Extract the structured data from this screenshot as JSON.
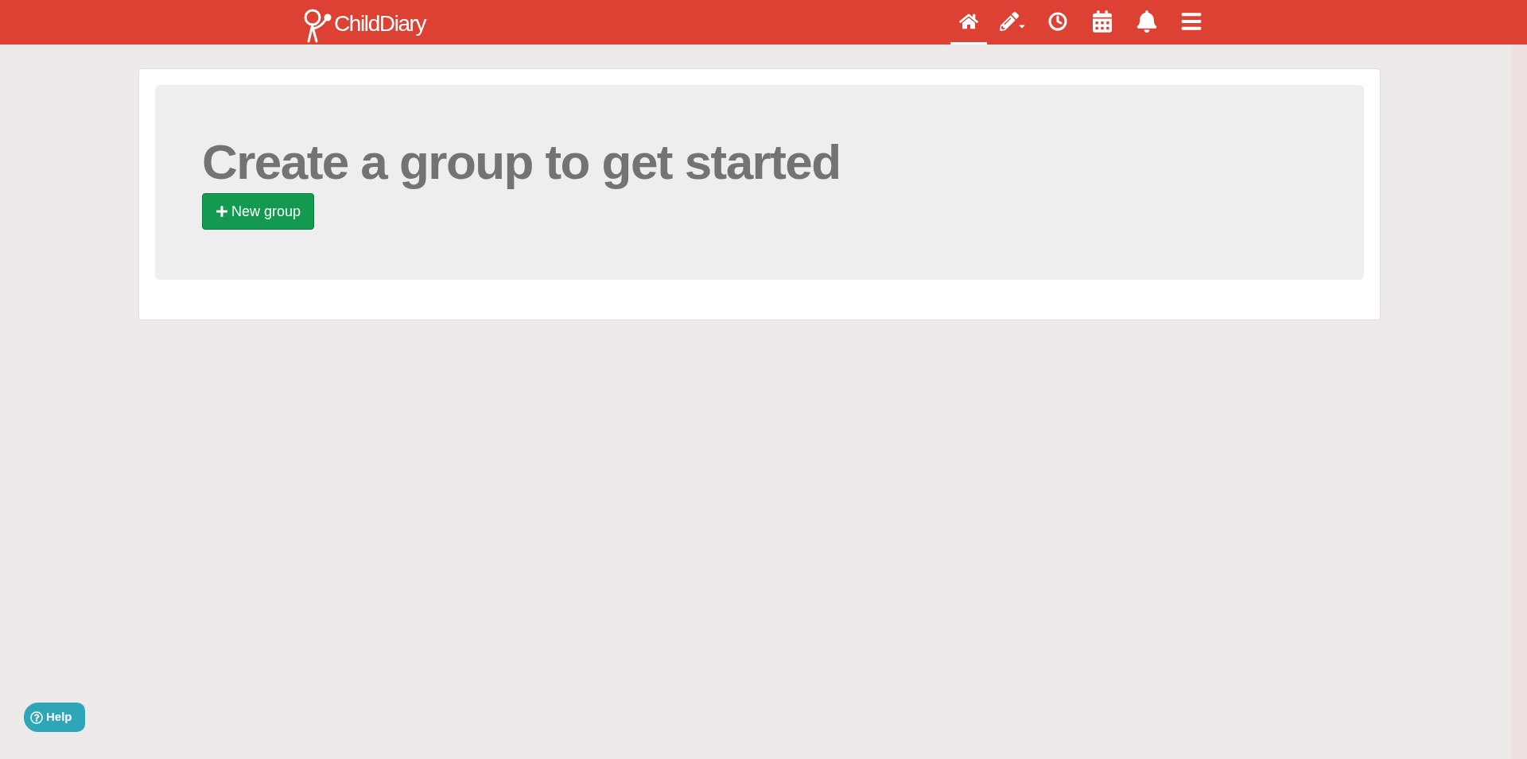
{
  "header": {
    "logo": "ChildDiary",
    "nav": [
      {
        "kind": "home",
        "selected": true
      },
      {
        "kind": "pencil",
        "selected": false
      },
      {
        "kind": "clock",
        "selected": false
      },
      {
        "kind": "calendar",
        "selected": false
      },
      {
        "kind": "bell",
        "selected": false
      },
      {
        "kind": "menu",
        "selected": false
      }
    ]
  },
  "main": {
    "heading": "Create a group to get started",
    "button": "New group"
  },
  "help": {
    "label": "Help"
  }
}
